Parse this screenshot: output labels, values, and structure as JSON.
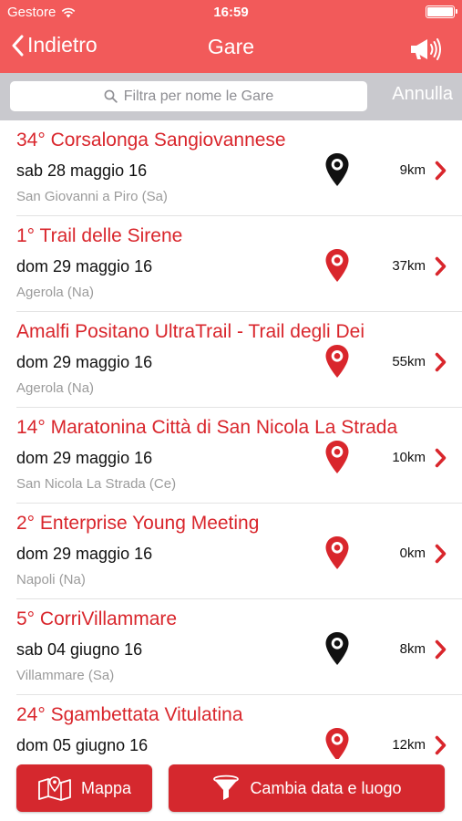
{
  "status_bar": {
    "carrier": "Gestore",
    "time": "16:59"
  },
  "nav": {
    "back_label": "Indietro",
    "title": "Gare",
    "action_icon": "megaphone-icon"
  },
  "search": {
    "placeholder": "Filtra per nome le Gare",
    "cancel_label": "Annulla"
  },
  "colors": {
    "header": "#f25a5a",
    "accent": "#d9262c",
    "button": "#d5282e",
    "pin_red": "#d9262c",
    "pin_black": "#111111"
  },
  "races": [
    {
      "title": "34° Corsalonga Sangiovannese",
      "date": "sab 28 maggio 16",
      "location": "San Giovanni a Piro (Sa)",
      "distance": "9km",
      "pin": "black"
    },
    {
      "title": "1° Trail delle Sirene",
      "date": "dom 29 maggio 16",
      "location": "Agerola (Na)",
      "distance": "37km",
      "pin": "red"
    },
    {
      "title": "Amalfi Positano UltraTrail - Trail degli Dei",
      "date": "dom 29 maggio 16",
      "location": "Agerola (Na)",
      "distance": "55km",
      "pin": "red"
    },
    {
      "title": "14° Maratonina Città di San Nicola La Strada",
      "date": "dom 29 maggio 16",
      "location": "San Nicola La Strada (Ce)",
      "distance": "10km",
      "pin": "red"
    },
    {
      "title": "2° Enterprise Young Meeting",
      "date": "dom 29 maggio 16",
      "location": "Napoli (Na)",
      "distance": "0km",
      "pin": "red"
    },
    {
      "title": "5° CorriVillammare",
      "date": "sab 04 giugno 16",
      "location": "Villammare (Sa)",
      "distance": "8km",
      "pin": "black"
    },
    {
      "title": "24° Sgambettata Vitulatina",
      "date": "dom 05 giugno 16",
      "location": "",
      "distance": "12km",
      "pin": "red"
    }
  ],
  "bottom": {
    "map_label": "Mappa",
    "map_icon": "map-icon",
    "filter_label": "Cambia data e luogo",
    "filter_icon": "funnel-icon"
  }
}
